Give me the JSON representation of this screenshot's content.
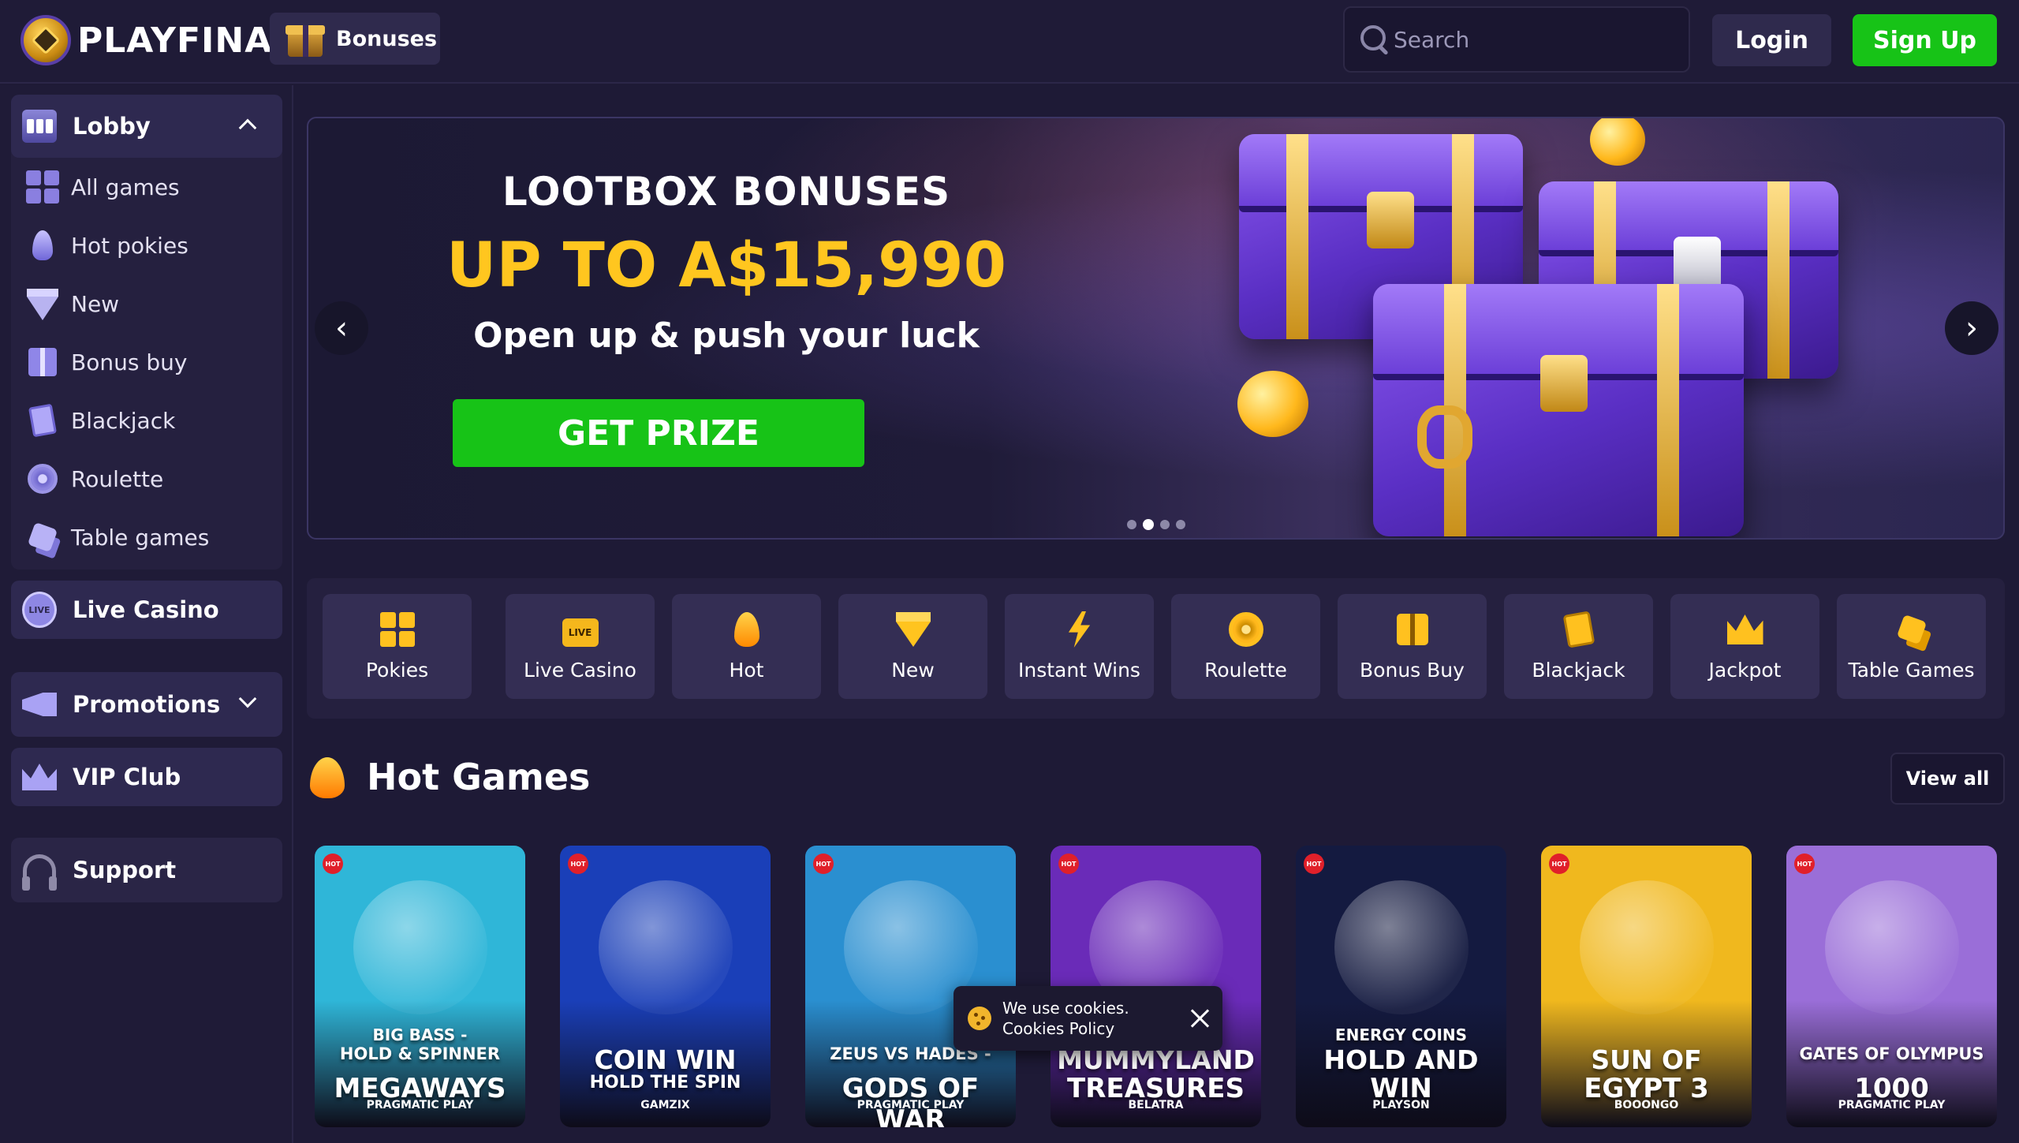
{
  "header": {
    "logo_text": "PLAYFINA",
    "bonuses_label": "Bonuses",
    "search_placeholder": "Search",
    "login_label": "Login",
    "signup_label": "Sign Up"
  },
  "sidebar": {
    "lobby_label": "Lobby",
    "items": [
      {
        "label": "All games",
        "icon": "grid-icon"
      },
      {
        "label": "Hot pokies",
        "icon": "flame-icon"
      },
      {
        "label": "New",
        "icon": "diamond-icon"
      },
      {
        "label": "Bonus buy",
        "icon": "gift-icon"
      },
      {
        "label": "Blackjack",
        "icon": "cards-icon"
      },
      {
        "label": "Roulette",
        "icon": "roulette-icon"
      },
      {
        "label": "Table games",
        "icon": "dice-icon"
      }
    ],
    "live_casino_label": "Live Casino",
    "live_icon_text": "LIVE",
    "promotions_label": "Promotions",
    "vip_label": "VIP Club",
    "support_label": "Support"
  },
  "hero": {
    "title": "LOOTBOX BONUSES",
    "amount": "UP TO A$15,990",
    "subtitle": "Open up & push your luck",
    "cta_label": "GET PRIZE",
    "prev_label": "‹",
    "next_label": "›",
    "slides_total": 4,
    "active_slide": 2
  },
  "categories": [
    {
      "label": "Pokies",
      "icon": "pokies-icon"
    },
    {
      "label": "Live Casino",
      "icon": "live-casino-icon"
    },
    {
      "label": "Hot",
      "icon": "flame-icon"
    },
    {
      "label": "New",
      "icon": "diamond-icon"
    },
    {
      "label": "Instant Wins",
      "icon": "lightning-icon"
    },
    {
      "label": "Roulette",
      "icon": "roulette-icon"
    },
    {
      "label": "Bonus Buy",
      "icon": "gift-icon"
    },
    {
      "label": "Blackjack",
      "icon": "cards-icon"
    },
    {
      "label": "Jackpot",
      "icon": "crown-icon"
    },
    {
      "label": "Table Games",
      "icon": "dice-icon"
    }
  ],
  "category_live_icon_text": "LIVE",
  "hot_games": {
    "title": "Hot Games",
    "view_all_label": "View all",
    "badge": "HOT",
    "games": [
      {
        "line1": "BIG BASS -",
        "line2": "HOLD & SPINNER",
        "line3": "MEGAWAYS",
        "provider": "PRAGMATIC PLAY",
        "bg": "#2fb6d8"
      },
      {
        "line1": "",
        "line2": "COIN WIN",
        "line3": "HOLD THE SPIN",
        "provider": "GAMZIX",
        "bg": "#1a3fb8"
      },
      {
        "line1": "",
        "line2": "ZEUS VS HADES -",
        "line3": "GODS OF WAR",
        "provider": "PRAGMATIC PLAY",
        "bg": "#2a8fd0"
      },
      {
        "line1": "",
        "line2": "MUMMYLAND",
        "line3": "TREASURES",
        "provider": "BELATRA",
        "bg": "#6a2bb8"
      },
      {
        "line1": "ENERGY COINS",
        "line2": "HOLD AND",
        "line3": "WIN",
        "provider": "PLAYSON",
        "bg": "#141a40"
      },
      {
        "line1": "",
        "line2": "SUN OF",
        "line3": "EGYPT 3",
        "provider": "BOOONGO",
        "bg": "#f0b81e"
      },
      {
        "line1": "",
        "line2": "GATES OF OLYMPUS",
        "line3": "1000",
        "provider": "PRAGMATIC PLAY",
        "bg": "#9a6ed8"
      }
    ]
  },
  "cookie": {
    "line1": "We use cookies.",
    "line2": "Cookies Policy"
  },
  "colors": {
    "accent_green": "#17c317",
    "accent_gold": "#ffc61f",
    "hot_red": "#e0202a",
    "bg": "#1e1a36"
  }
}
